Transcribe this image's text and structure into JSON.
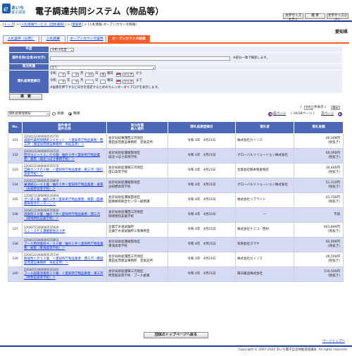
{
  "header": {
    "logo_line1": "あいち",
    "logo_line2": "電子調達",
    "system_title": "電子調達共同システム（物品等）",
    "font_larger": "文字サイズ大きく",
    "font_standard": "標 準",
    "font_smaller": "文字サイズ小さく"
  },
  "breadcrumb": {
    "top": "トップ",
    "bid_service": "入札情報サービス（団体選択）",
    "prefecture": "愛知県",
    "current": "入札情報-オープンカウンタ情報"
  },
  "organization": "愛知県",
  "tabs": [
    {
      "label": "入札案件（公告）",
      "active": false
    },
    {
      "label": "入札結果",
      "active": false
    },
    {
      "label": "オープンカウンタ案件",
      "active": false
    },
    {
      "label": "オープンカウンタ結果",
      "active": true
    }
  ],
  "search_form": {
    "fiscal_year_label": "年度",
    "fiscal_year_value": "令和 4年度",
    "case_name_label": "案件名称",
    "case_name_sub": "(全角30文字)",
    "case_name_value": "",
    "case_name_hint": "※部分一致で検索します。",
    "department_label": "発注所属",
    "department_value": "全て",
    "date_label": "開札結果登録日",
    "era": "令和",
    "from_year": "4",
    "from_month": "8",
    "from_day": "10",
    "from_weekday": "水",
    "to_year": "4",
    "to_month": "9",
    "to_day": "",
    "to_weekday": "",
    "year_unit": "年",
    "month_unit": "月",
    "day_unit": "日",
    "weekday_unit": "曜日",
    "clear_label": "クリア",
    "from_text": "から",
    "to_text": "まで",
    "calendar_note": "※画像を押下すると日付を指定するためのカレンダーダイアログを表示します。",
    "search_button": "検　索"
  },
  "results_toolbar": {
    "sort_field": "開札結果登録日",
    "ascending_label": "昇順",
    "descending_label": "降順",
    "sort_direction": "descending",
    "page_size_prefix": "(",
    "page_size_value": "10",
    "page_size_suffix": "件表示 )",
    "prev_label": "前ページ",
    "next_label": "次ページ",
    "page_info": "( 34/38ページ )",
    "display_button": "表示"
  },
  "table": {
    "columns": [
      "No.",
      "案件番号\n案件名称",
      "発注所属\n納入場所",
      "開札結果登録日",
      "落札者",
      "落札金額"
    ],
    "rows": [
      {
        "no": "331",
        "case_no": "2204122300000535735",
        "case_name": "滅菌代薬剤保健剤１０セット　＜愛知県庁物品業者：西三河（豊田加茂建設事務所　吊処支所）＞",
        "dept": "会計局知事課西三河地区",
        "place": "豊田加茂建設事務所　足助支所",
        "date": "令和 4年　4月21日",
        "winner": "株式会社カイノス",
        "amount": "46,008円",
        "tax": "(税抜き)"
      },
      {
        "no": "332",
        "case_no": "2204122300000535723",
        "case_name": "空冷ユニット１，００個　抽の３件＜愛知県庁物品業者：尾張（城北つばさ事務学校）＞",
        "dept": "会計局財産課尾張地区",
        "place": "城北つばさ高等学校",
        "date": "令和 4年　4月21日",
        "winner": "グローバルソリューション株式会社",
        "amount": "60,000円",
        "tax": "(税抜き)"
      },
      {
        "no": "333",
        "case_no": "2204122300000535572",
        "case_name": "自動カンナ刃３枚　＜愛知県庁物品業者：東三河（田口高等学校）＞",
        "dept": "会計局財産課東三河地区",
        "place": "田口高等学校",
        "date": "令和 4年　4月21日",
        "winner": "合資会社櫛本製金物店",
        "amount": "34,440円",
        "tax": "(税抜き)"
      },
      {
        "no": "334",
        "case_no": "2204122300000535859",
        "case_name": "乗浦紙ロール１個　抽の５件＜愛知県庁物品業者：尾張（古知野高等学校）＞",
        "dept": "会計局財産課尾張地区",
        "place": "古知野高等学校",
        "date": "令和 4年　4月21日",
        "winner": "グローバルソリューション株式会社",
        "amount": "51,310円",
        "tax": "(税抜き)"
      },
      {
        "no": "335",
        "case_no": "2204072300000535064",
        "case_name": "ポリ袋１箱　抽の３件＜愛知県庁物品業者：尾張（医療療育総合センター）＞",
        "dept": "会計局財産課尾張地区",
        "place": "医療療育総合センター総務課",
        "date": "令和 4年　4月21日",
        "winner": "株式会社リブライト",
        "amount": "41,700円",
        "tax": "(税抜き)"
      },
      {
        "no": "336",
        "case_no": "2204122300000535826",
        "case_name": "消臭剤２０個　抽の７件＜愛知県庁物品業者：西三河（岡崎特別支援学校）＞",
        "dept": "会計局財産課西三河地区",
        "place": "岡崎特別支援学校",
        "date": "令和 4年　4月21日",
        "winner": "—",
        "amount": "不調",
        "tax": ""
      },
      {
        "no": "337",
        "case_no": "2204072300000535029",
        "case_name": "ＧＬ－ＳＰＥ濃縮管柱の３件",
        "dept": "企業庁水道試験所",
        "place": "企業庁水道試験所２階事務室",
        "date": "令和 4年　4月21日",
        "winner": "株式会社ケミコ／西村",
        "amount": "401,849円",
        "tax": "(税抜き)"
      },
      {
        "no": "338",
        "case_no": "2204122300000535852",
        "case_name": "プール用消毒剤４，００箱　抽の１件＜愛知県庁物品業者：尾張（東海高等学校）＞",
        "dept": "会計局財産課尾張地区",
        "place": "東海高等学校",
        "date": "令和 4年　4月21日",
        "winner": "有限会社タマヤ",
        "amount": "92,996円",
        "tax": "(税抜き)"
      },
      {
        "no": "339",
        "case_no": "2204122300000535734",
        "case_name": "耐候性とのう３個　＜愛知県庁物品業者：西三河（豊田加茂建設事務所　吊処支所）＞",
        "dept": "会計局財産課西三河地区",
        "place": "豊田加茂建設事務所　足助支所",
        "date": "令和 4年　4月21日",
        "winner": "株式会社カイノス",
        "amount": "46,500円",
        "tax": "(税抜き)"
      },
      {
        "no": "340",
        "case_no": "2204072300000535165",
        "case_name": "プール殺菌消毒剤３５箱　＜愛知県庁物品業者：東三河（時習館高等学校）＞",
        "dept": "会計局財産課東三河地区",
        "place": "時習館高等学校　プール倉庫",
        "date": "令和 4年　4月21日",
        "winner": "陽日薬品株式会社",
        "amount": "110,500円",
        "tax": "(税抜き)"
      }
    ]
  },
  "footer": {
    "back_button": "団体のトップページへ戻る",
    "page_top": "ページトップへ",
    "copyright": "Copyright © 2007-2022 あいち電子自治体推進協議会. All rights reserved."
  },
  "colors": {
    "header_rule": "#1c3f9b",
    "tab_active": "#ff5c2a",
    "form_label_bg": "#4b67b6",
    "row_alt_bg": "#d6daf2"
  }
}
